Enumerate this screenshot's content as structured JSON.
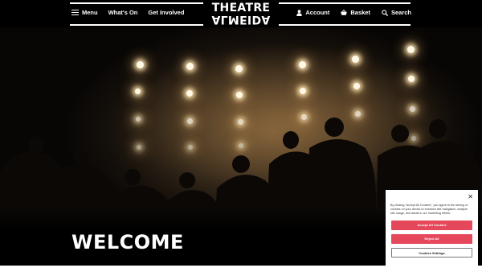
{
  "header": {
    "menu_label": "Menu",
    "whats_on_label": "What's On",
    "get_involved_label": "Get Involved",
    "logo_top": "THEATRE",
    "logo_bottom": "ALMEIDA",
    "account_label": "Account",
    "basket_label": "Basket",
    "search_label": "Search"
  },
  "hero": {
    "heading": "WELCOME"
  },
  "cookie_banner": {
    "text": "By clicking “Accept All Cookies”, you agree to the storing of cookies on your device to enhance site navigation, analyze site usage, and assist in our marketing efforts.",
    "accept_label": "Accept All Cookies",
    "reject_label": "Reject All",
    "settings_label": "Cookies Settings",
    "close_icon": "close-icon"
  },
  "icons": {
    "menu": "hamburger-icon",
    "account": "user-icon",
    "basket": "basket-icon",
    "search": "search-icon"
  },
  "colors": {
    "background": "#000000",
    "accent": "#e5485b",
    "text": "#ffffff"
  }
}
